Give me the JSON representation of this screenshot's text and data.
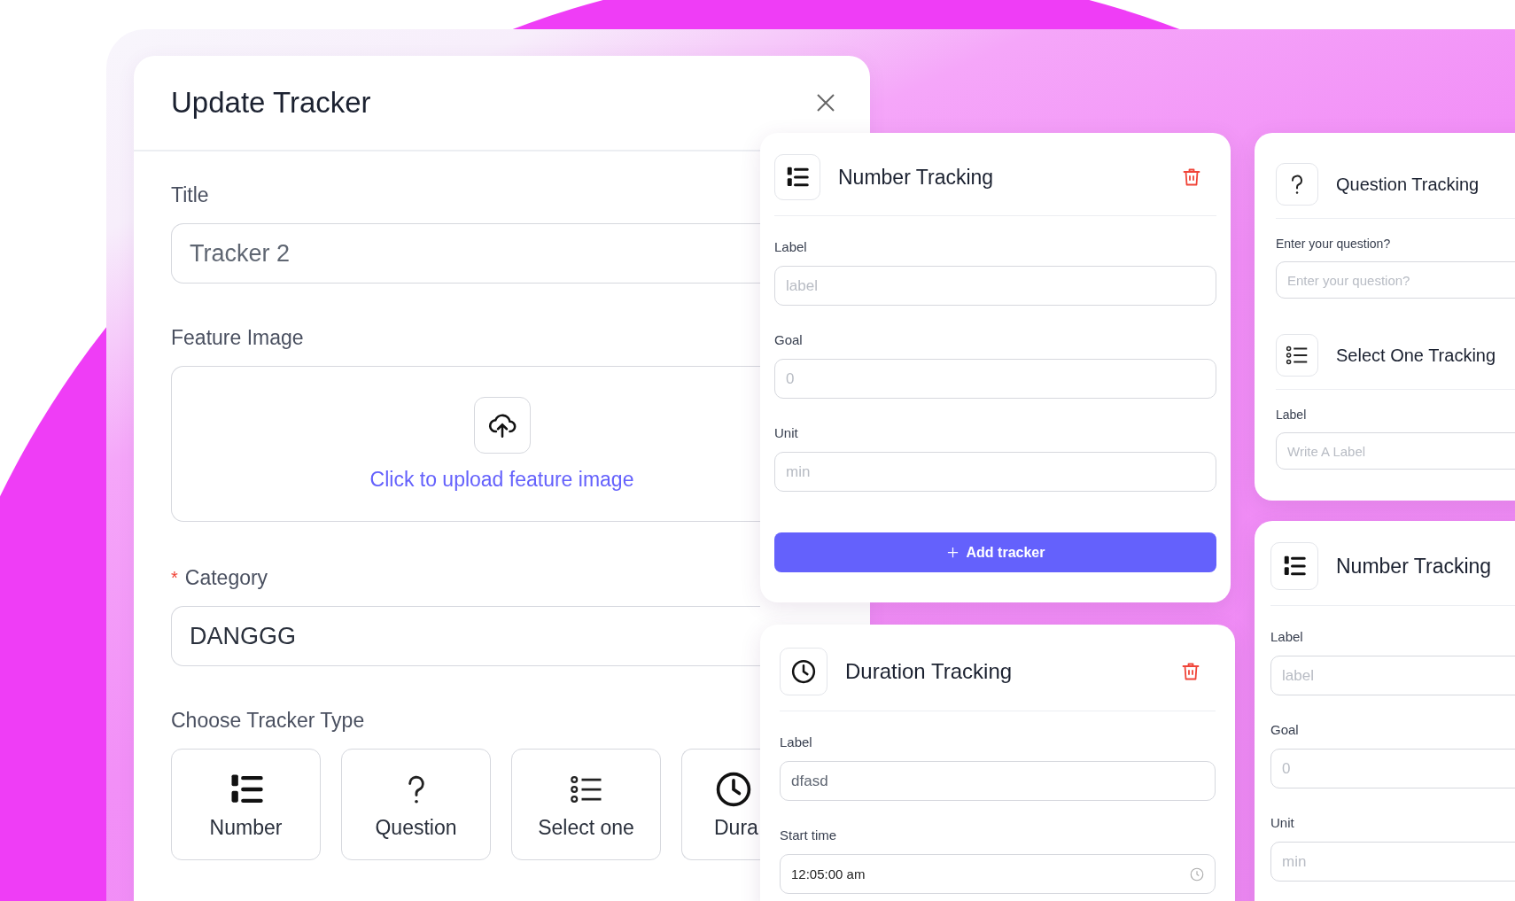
{
  "modal": {
    "title": "Update Tracker",
    "title_field": {
      "label": "Title",
      "value": "Tracker 2"
    },
    "feature_image": {
      "label": "Feature Image",
      "upload_text": "Click to upload feature image"
    },
    "category": {
      "label": "Category",
      "required_mark": "*",
      "value": "DANGGG"
    },
    "tracker_type": {
      "label": "Choose Tracker Type",
      "options": [
        {
          "kind": "number",
          "label": "Number"
        },
        {
          "kind": "question",
          "label": "Question"
        },
        {
          "kind": "select",
          "label": "Select one"
        },
        {
          "kind": "duration",
          "label": "Dura"
        }
      ]
    }
  },
  "cards": [
    {
      "sections": [
        {
          "kind": "number",
          "title": "Number Tracking",
          "deletable": true,
          "fields": [
            {
              "kind": "text",
              "label": "Label",
              "placeholder": "label"
            },
            {
              "kind": "text",
              "label": "Goal",
              "placeholder": "0"
            },
            {
              "kind": "text",
              "label": "Unit",
              "placeholder": "min"
            }
          ]
        }
      ],
      "button": "Add tracker"
    },
    {
      "sections": [
        {
          "kind": "duration",
          "title": "Duration Tracking",
          "deletable": true,
          "fields": [
            {
              "kind": "text",
              "label": "Label",
              "value": "dfasd"
            },
            {
              "kind": "time",
              "label": "Start time",
              "value": "12:05:00 am"
            }
          ]
        }
      ]
    },
    {
      "sections": [
        {
          "kind": "question",
          "title": "Question Tracking",
          "deletable": false,
          "fields": [
            {
              "kind": "text",
              "label": "Enter your question?",
              "placeholder": "Enter your question?"
            }
          ]
        },
        {
          "kind": "select",
          "title": "Select One Tracking",
          "deletable": false,
          "fields": [
            {
              "kind": "text",
              "label": "Label",
              "placeholder": "Write A Label"
            }
          ]
        }
      ]
    },
    {
      "sections": [
        {
          "kind": "number",
          "title": "Number Tracking",
          "deletable": false,
          "fields": [
            {
              "kind": "text",
              "label": "Label",
              "placeholder": "label"
            },
            {
              "kind": "text",
              "label": "Goal",
              "placeholder": "0"
            },
            {
              "kind": "text",
              "label": "Unit",
              "placeholder": "min"
            }
          ]
        }
      ]
    }
  ]
}
